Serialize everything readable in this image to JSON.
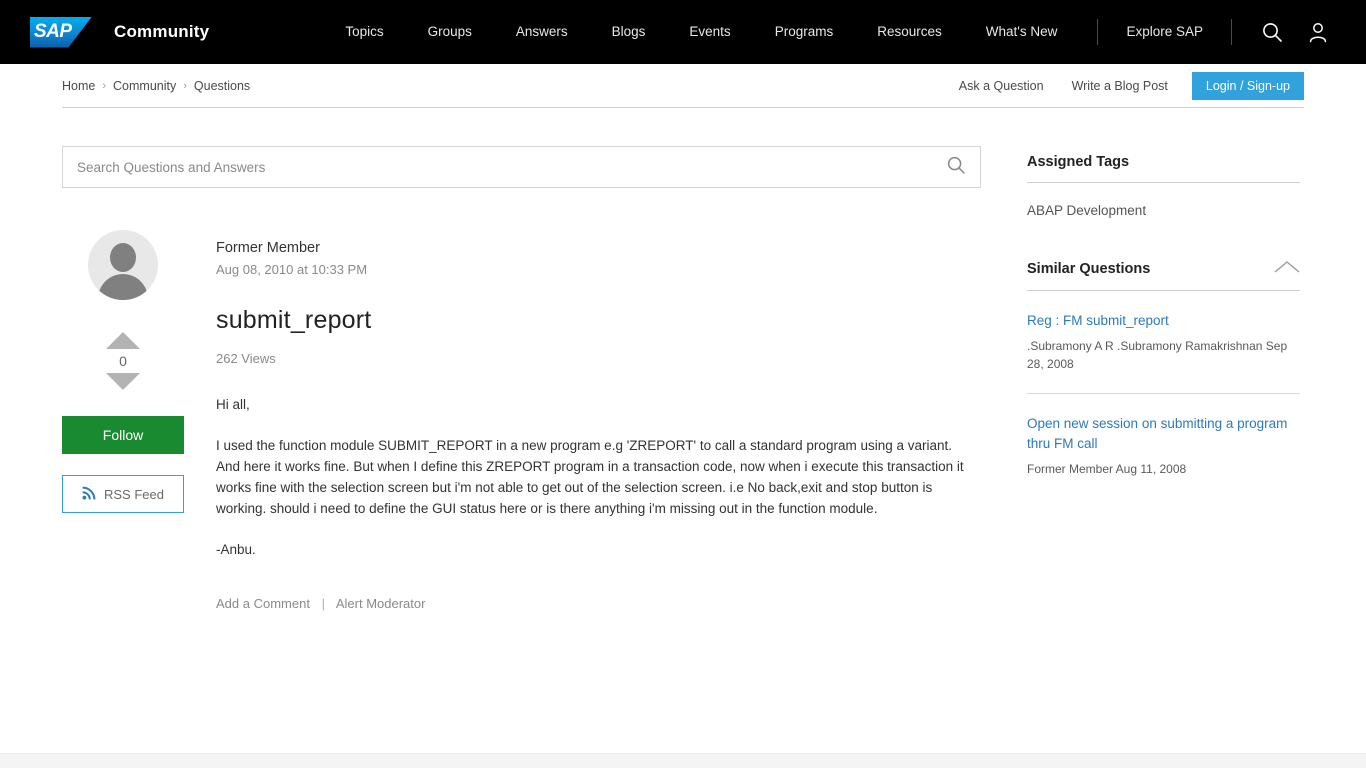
{
  "header": {
    "logo_text": "SAP",
    "brand_title": "Community",
    "nav": [
      {
        "label": "Topics"
      },
      {
        "label": "Groups"
      },
      {
        "label": "Answers"
      },
      {
        "label": "Blogs"
      },
      {
        "label": "Events"
      },
      {
        "label": "Programs"
      },
      {
        "label": "Resources"
      },
      {
        "label": "What's New"
      }
    ],
    "explore_label": "Explore SAP",
    "search_icon": "search-icon",
    "account_icon": "user-account-icon"
  },
  "breadcrumb": {
    "items": [
      "Home",
      "Community",
      "Questions"
    ],
    "separator": "›",
    "ask_label": "Ask a Question",
    "blog_label": "Write a Blog Post",
    "login_label": "Login / Sign-up"
  },
  "search": {
    "placeholder": "Search Questions and Answers",
    "value": ""
  },
  "question": {
    "author": "Former Member",
    "date": "Aug 08, 2010 at 10:33 PM",
    "title": "submit_report",
    "views": "262 Views",
    "vote_count": "0",
    "follow_label": "Follow",
    "rss_label": "RSS Feed",
    "paragraphs": [
      "Hi all,",
      "I used the function module SUBMIT_REPORT in a new program e.g 'ZREPORT' to call a standard program using a variant. And here it works fine. But when I define this ZREPORT program in a transaction code, now when i execute this transaction it works fine with the selection screen but i'm not able to get out of the selection screen. i.e No back,exit and stop button is working. should i need to define the GUI status here or is there anything i'm missing out in the function module.",
      "-Anbu."
    ],
    "add_comment_label": "Add a Comment",
    "action_divider": "|",
    "alert_moderator_label": "Alert Moderator"
  },
  "sidebar": {
    "assigned_tags_title": "Assigned Tags",
    "tags": [
      "ABAP Development"
    ],
    "similar_questions_title": "Similar Questions",
    "similar_questions": [
      {
        "title": "Reg : FM submit_report",
        "meta": ".Subramony A R .Subramony Ramakrishnan   Sep 28, 2008"
      },
      {
        "title": "Open new session on submitting a program thru FM call",
        "meta": "Former Member   Aug 11, 2008"
      }
    ]
  },
  "colors": {
    "brand_blue": "#31a2dc",
    "link_blue": "#2b7bb9",
    "follow_green": "#198a30",
    "nav_black": "#000000"
  }
}
